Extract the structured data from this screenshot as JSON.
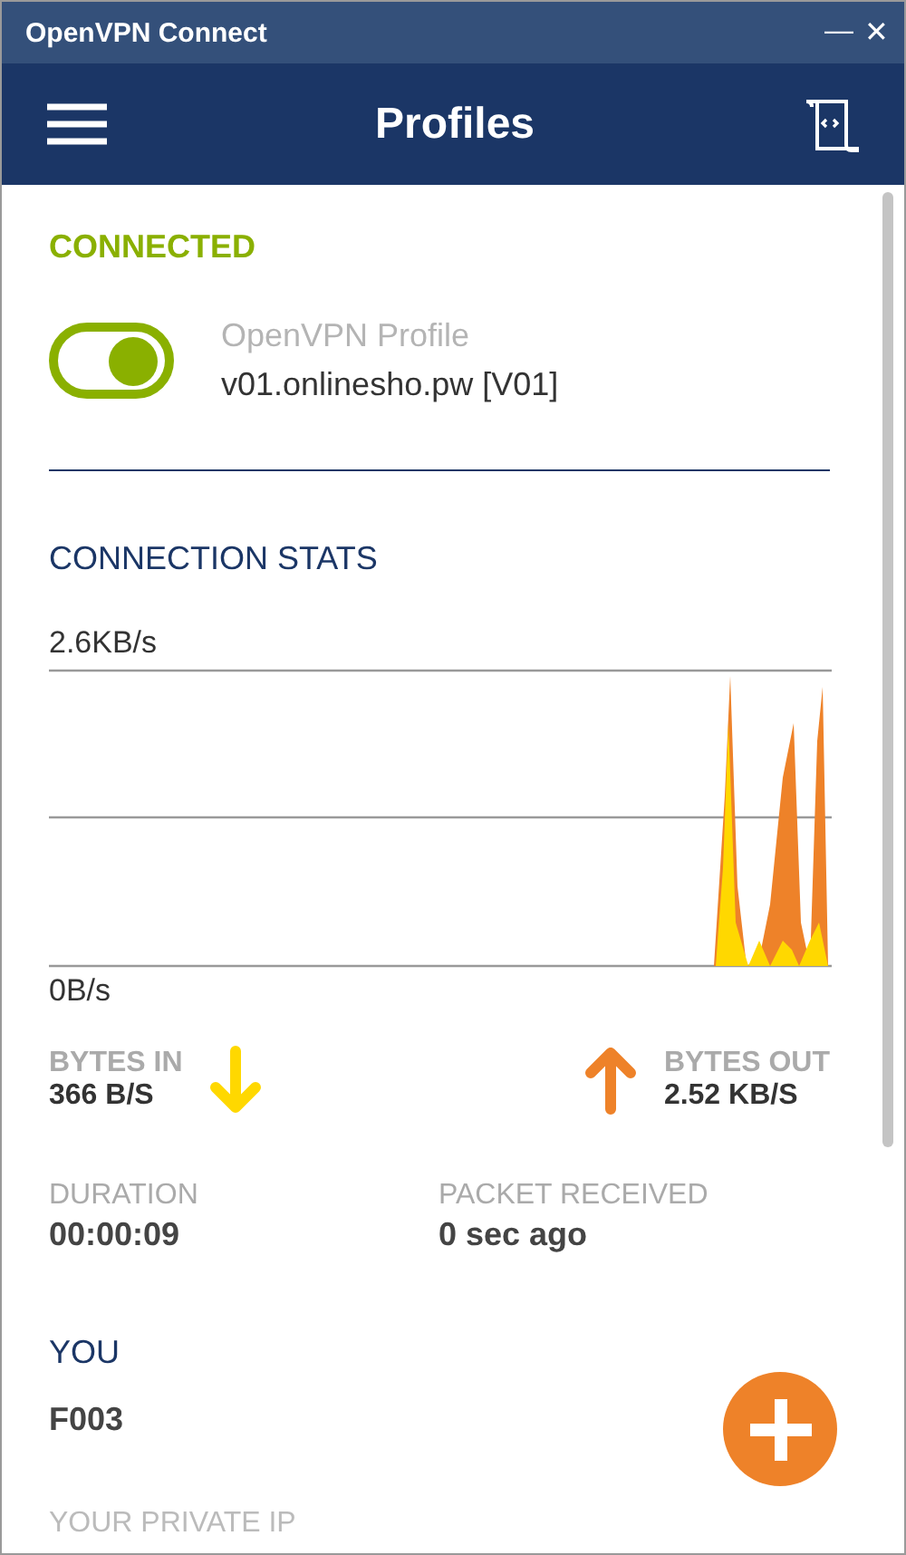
{
  "window": {
    "title": "OpenVPN Connect",
    "controls": [
      "—",
      "✕"
    ]
  },
  "header": {
    "title": "Profiles"
  },
  "connection": {
    "status": "CONNECTED",
    "on": true,
    "profile_label": "OpenVPN Profile",
    "profile_name": "v01.onlinesho.pw [V01]"
  },
  "stats": {
    "title": "CONNECTION STATS",
    "max_label": "2.6KB/s",
    "min_label": "0B/s",
    "rates": [
      {
        "kind": "in",
        "label": "BYTES IN",
        "value": "366 B/S",
        "color": "#ffd800"
      },
      {
        "kind": "out",
        "label": "BYTES OUT",
        "value": "2.52 KB/S",
        "color": "#ee8229"
      }
    ],
    "details": [
      {
        "label": "DURATION",
        "value": "00:00:09"
      },
      {
        "label": "PACKET RECEIVED",
        "value": "0 sec ago"
      }
    ]
  },
  "you": {
    "title": "YOU",
    "name": "F003",
    "next_label": "YOUR PRIVATE IP"
  }
}
